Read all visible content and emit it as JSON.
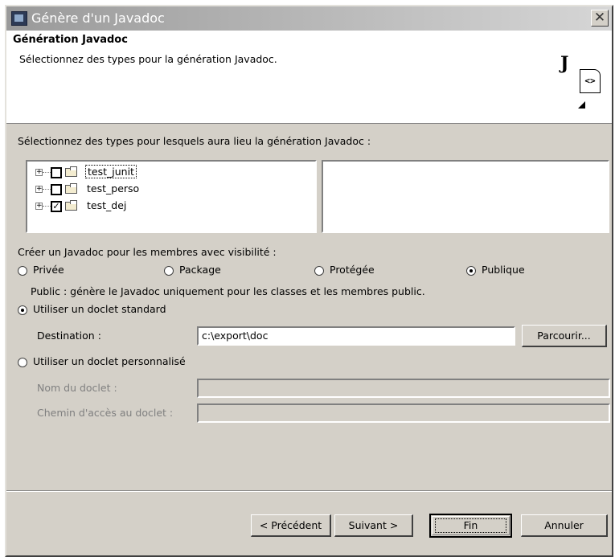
{
  "window": {
    "title": "Génère d'un Javadoc",
    "close_glyph": "✕"
  },
  "header": {
    "title": "Génération Javadoc",
    "description": "Sélectionnez des types pour la génération Javadoc.",
    "icon_letter": "J",
    "icon_glyph": "<>"
  },
  "types": {
    "label": "Sélectionnez des types pour lesquels aura lieu la génération Javadoc :",
    "tree": [
      {
        "label": "test_junit",
        "checked": false,
        "selected": true
      },
      {
        "label": "test_perso",
        "checked": false,
        "selected": false
      },
      {
        "label": "test_dej",
        "checked": true,
        "selected": false
      }
    ],
    "expander_glyph": "+",
    "check_glyph": "✓"
  },
  "visibility": {
    "label": "Créer un Javadoc pour les membres avec visibilité :",
    "options": [
      {
        "label": "Privée",
        "selected": false
      },
      {
        "label": "Package",
        "selected": false
      },
      {
        "label": "Protégée",
        "selected": false
      },
      {
        "label": "Publique",
        "selected": true
      }
    ],
    "description": "Public : génère le Javadoc uniquement pour les classes et les membres public."
  },
  "doclet": {
    "standard_label": "Utiliser un doclet standard",
    "standard_selected": true,
    "destination_label": "Destination :",
    "destination_value": "c:\\export\\doc",
    "browse_label": "Parcourir...",
    "custom_label": "Utiliser un doclet personnalisé",
    "custom_selected": false,
    "doclet_name_label": "Nom du doclet :",
    "doclet_name_value": "",
    "doclet_path_label": "Chemin d'accès au doclet :",
    "doclet_path_value": ""
  },
  "buttons": {
    "previous": "< Précédent",
    "next": "Suivant >",
    "finish": "Fin",
    "cancel": "Annuler"
  }
}
